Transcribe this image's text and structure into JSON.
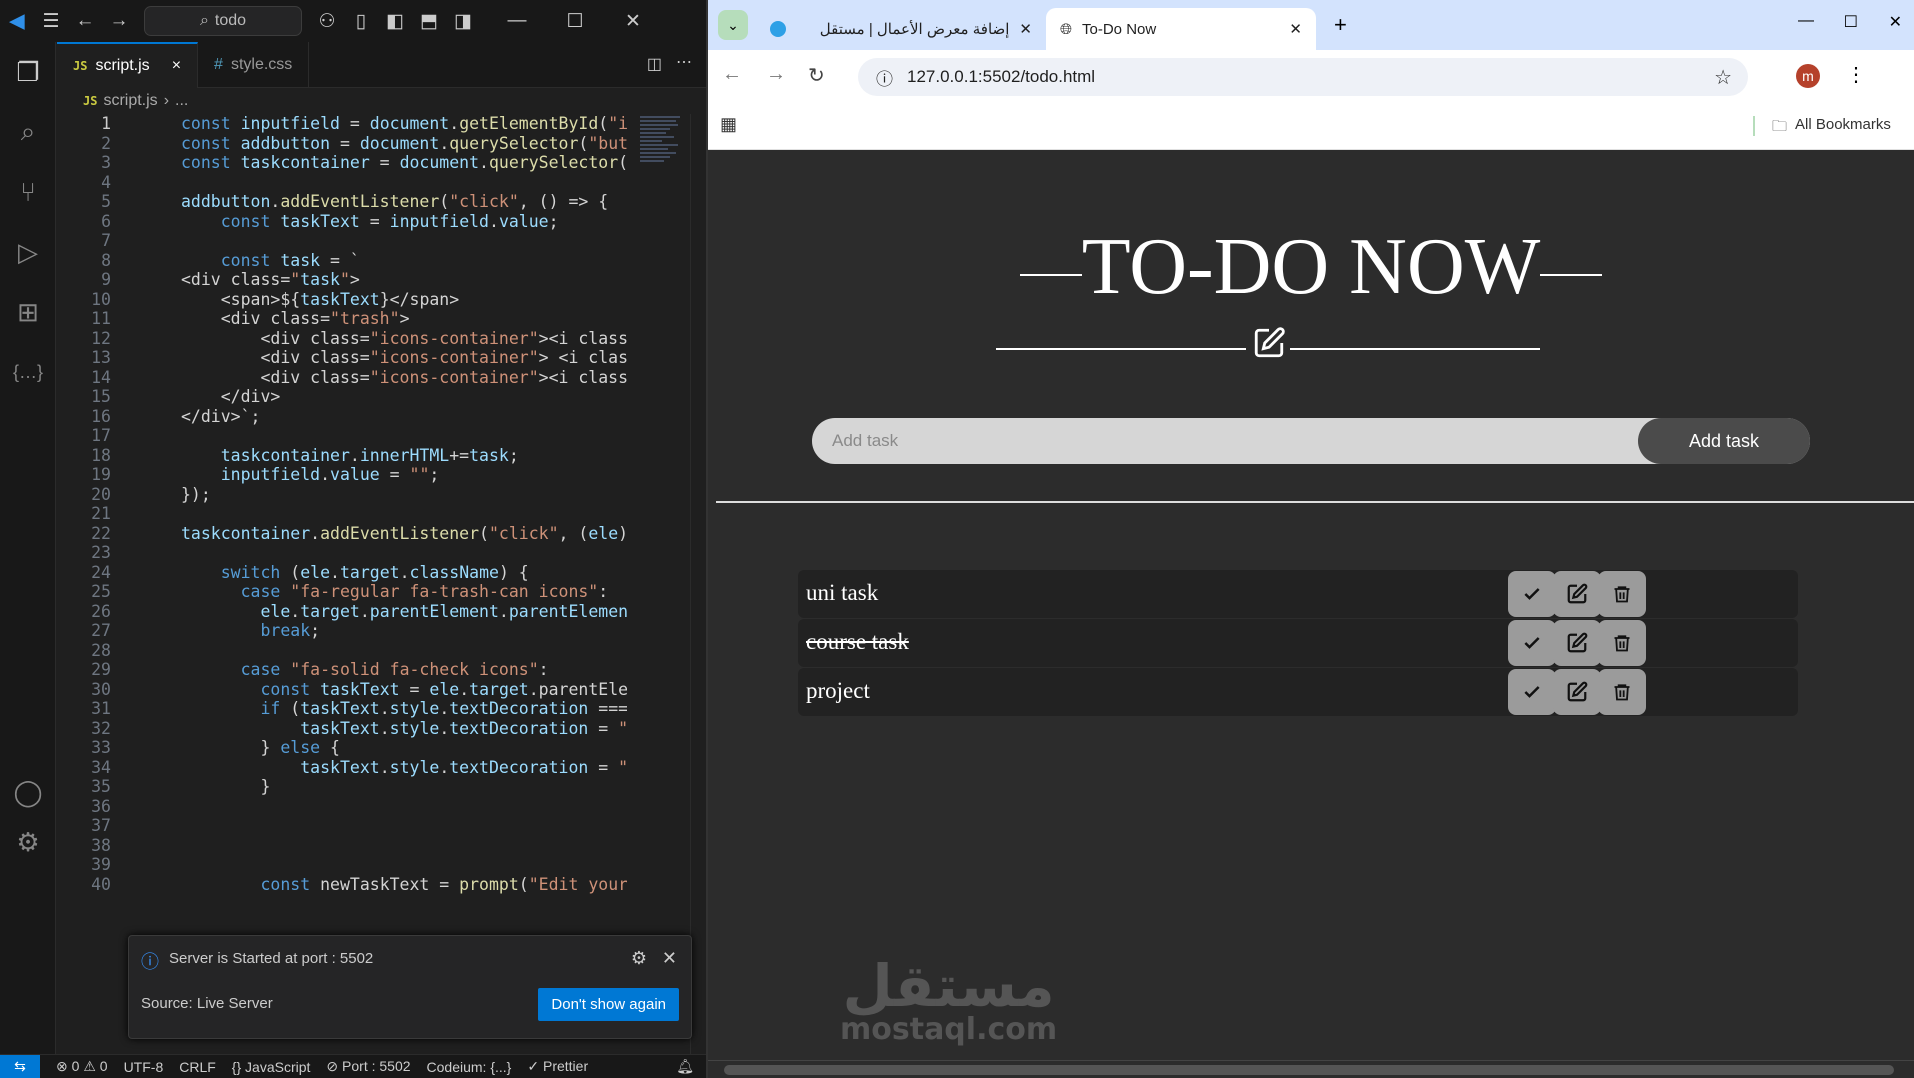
{
  "vscode": {
    "search_label": "todo",
    "tabs": [
      {
        "label": "script.js",
        "close": "×"
      },
      {
        "label": "style.css"
      }
    ],
    "breadcrumb": {
      "file": "script.js",
      "rest": "..."
    },
    "code_lines": [
      "const inputfield = document.getElementById(\"inp",
      "const addbutton = document.querySelector(\"butto",
      "const taskcontainer = document.querySelector(\".",
      "",
      "addbutton.addEventListener(\"click\", () => {",
      "    const taskText = inputfield.value;",
      "",
      "    const task = `",
      "<div class=\"task\">",
      "    <span>${taskText}</span>",
      "    <div class=\"trash\">",
      "        <div class=\"icons-container\"><i class=\"",
      "        <div class=\"icons-container\"> <i class=",
      "        <div class=\"icons-container\"><i class=\"",
      "    </div>",
      "</div>`;",
      "",
      "    taskcontainer.innerHTML+=task;",
      "    inputfield.value = \"\";",
      "});",
      "",
      "taskcontainer.addEventListener(\"click\", (ele) =",
      "",
      "    switch (ele.target.className) {",
      "      case \"fa-regular fa-trash-can icons\":",
      "        ele.target.parentElement.parentElement.",
      "        break;",
      "",
      "      case \"fa-solid fa-check icons\":",
      "        const taskText = ele.target.parentEleme",
      "        if (taskText.style.textDecoration === '",
      "            taskText.style.textDecoration = \"no",
      "        } else {",
      "            taskText.style.textDecoration = \"li",
      "        }",
      "",
      "",
      "",
      "",
      "        const newTaskText = prompt(\"Edit your t"
    ],
    "notification": {
      "message": "Server is Started at port : 5502",
      "source": "Source: Live Server",
      "button": "Don't show again"
    },
    "status": {
      "problems": "0",
      "warnings": "0",
      "encoding": "UTF-8",
      "eol": "CRLF",
      "language": "JavaScript",
      "port": "Port : 5502",
      "codeium": "Codeium: {...}",
      "prettier": "Prettier"
    }
  },
  "browser": {
    "tabs": [
      {
        "label": "إضافة معرض الأعمال | مستقل"
      },
      {
        "label": "To-Do Now"
      }
    ],
    "url": "127.0.0.1:5502/todo.html",
    "avatar": "m",
    "bookmarks_label": "All Bookmarks",
    "page": {
      "title": "TO-DO NOW",
      "input_placeholder": "Add task",
      "add_button": "Add task",
      "tasks": [
        {
          "text": "uni task",
          "done": false
        },
        {
          "text": "course task",
          "done": true
        },
        {
          "text": "project",
          "done": false
        }
      ],
      "watermark_ar": "مستقل",
      "watermark_en": "mostaql.com"
    }
  }
}
